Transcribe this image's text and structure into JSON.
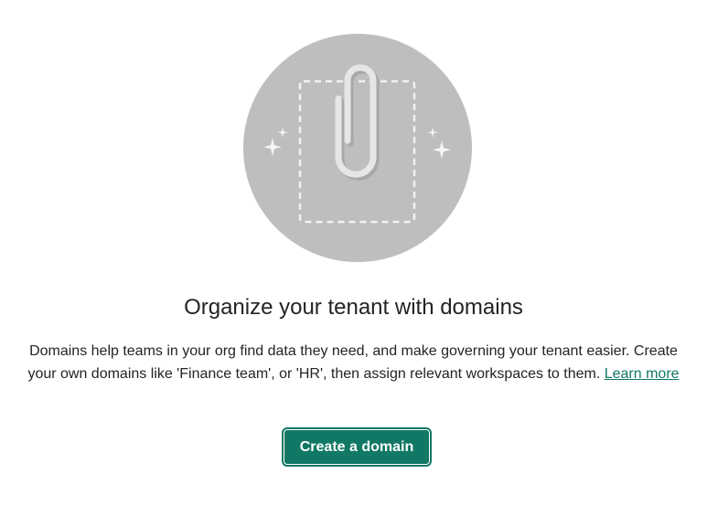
{
  "empty_state": {
    "heading": "Organize your tenant with domains",
    "description": "Domains help teams in your org find data they need, and make governing your tenant easier. Create your own domains like 'Finance team', or 'HR', then assign relevant workspaces to them.",
    "learn_more_label": "Learn more",
    "create_button_label": "Create a domain"
  },
  "colors": {
    "accent": "#117865",
    "illustration_circle": "#bebebe",
    "text": "#242424"
  },
  "icons": {
    "illustration": "paperclip-folder-icon",
    "sparkle": "sparkle-icon"
  }
}
